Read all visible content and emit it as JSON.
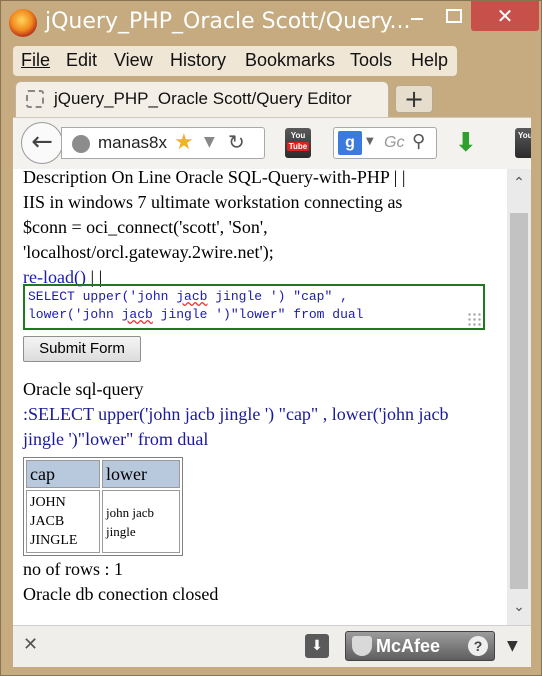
{
  "window": {
    "title": "jQuery_PHP_Oracle Scott/Query...",
    "close_glyph": "✕"
  },
  "menu": [
    "File",
    "Edit",
    "View",
    "History",
    "Bookmarks",
    "Tools",
    "Help"
  ],
  "tabs": [
    {
      "title": "jQuery_PHP_Oracle Scott/Query Editor",
      "active": true
    }
  ],
  "new_tab_label": "+",
  "navbar": {
    "url": "manas8x",
    "search_placeholder": "Gc",
    "search_engine": "g"
  },
  "page": {
    "description_lines": [
      "Description On Line Oracle SQL-Query-with-PHP | |",
      "IIS in windows 7 ultimate workstation connecting as",
      "$conn = oci_connect('scott', 'Son',",
      "'localhost/orcl.gateway.2wire.net');"
    ],
    "reload_link": "re-load()",
    "reload_suffix": "| |",
    "editor_line1_a": "SELECT upper('john ",
    "editor_line1_err": "jacb",
    "editor_line1_b": " jingle ') \"cap\" ,",
    "editor_line2_a": "lower('john ",
    "editor_line2_err": "jacb",
    "editor_line2_b": " jingle ')\"lower\" from dual",
    "submit_label": "Submit Form",
    "query_heading": "Oracle sql-query",
    "query_text": ":SELECT upper('john jacb jingle ') \"cap\" , lower('john jacb jingle ')\"lower\" from dual",
    "table": {
      "headers": [
        "cap",
        "lower"
      ],
      "rows": [
        {
          "cap_lines": [
            "JOHN",
            "JACB",
            "JINGLE"
          ],
          "lower_lines": [
            "john jacb",
            "jingle"
          ]
        }
      ]
    },
    "rowcount": "no of rows : 1",
    "closed_msg": "Oracle db conection closed"
  },
  "addon_bar": {
    "close_glyph": "✕",
    "mcafee_label": "McAfee",
    "help_glyph": "?"
  },
  "icons": [
    "firefox-icon",
    "back-arrow-icon",
    "globe-icon",
    "star-icon",
    "reload-icon",
    "youtube-icon",
    "google-icon",
    "search-icon",
    "download-icon",
    "mcafee-shield-icon"
  ]
}
